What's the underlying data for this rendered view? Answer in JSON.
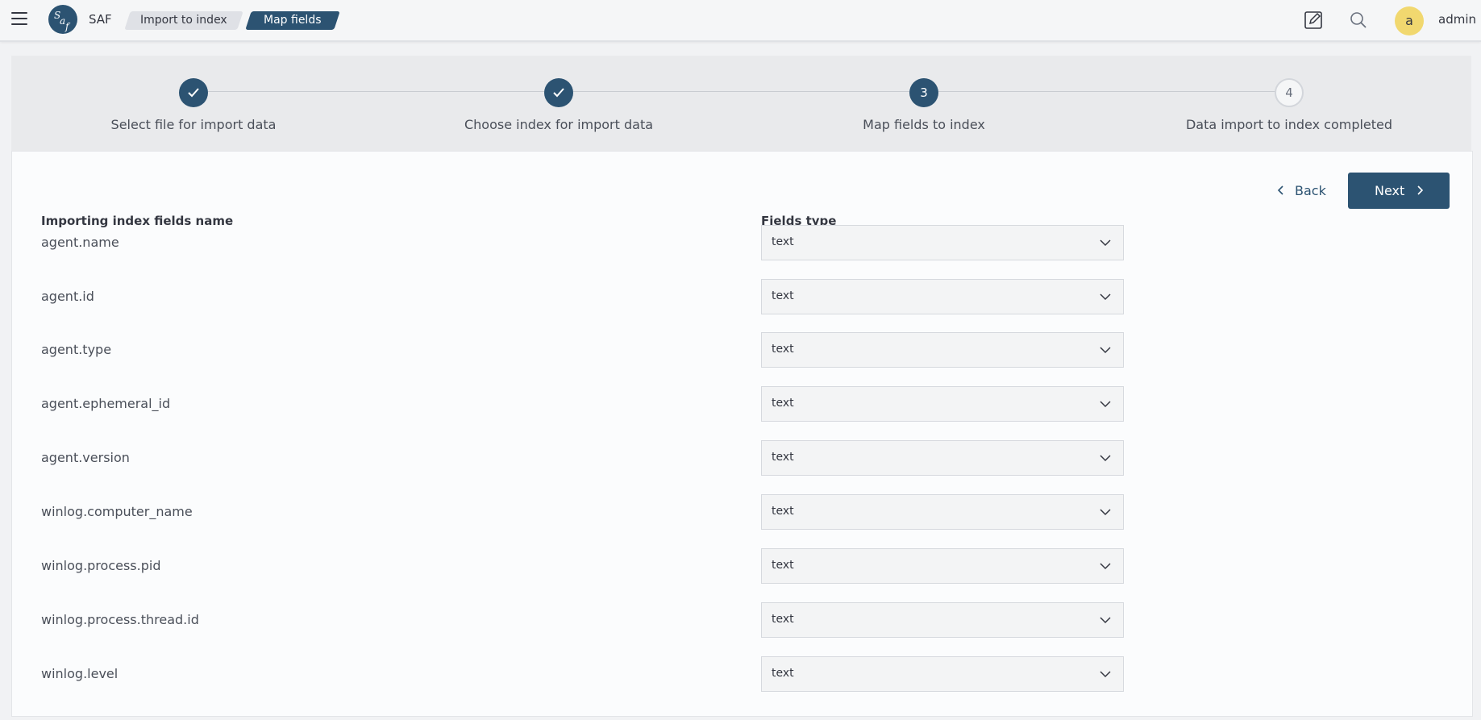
{
  "header": {
    "app_name": "SAF",
    "breadcrumbs": [
      "Import to index",
      "Map fields"
    ],
    "user": {
      "initial": "a",
      "name": "admin"
    },
    "icons": [
      "menu-icon",
      "saf-logo",
      "edit-icon",
      "search-icon"
    ]
  },
  "stepper": {
    "steps": [
      {
        "label": "Select file for import data",
        "state": "done",
        "marker": "✓"
      },
      {
        "label": "Choose index for import data",
        "state": "done",
        "marker": "✓"
      },
      {
        "label": "Map fields to index",
        "state": "current",
        "marker": "3"
      },
      {
        "label": "Data import to index completed",
        "state": "todo",
        "marker": "4"
      }
    ]
  },
  "actions": {
    "back_label": "Back",
    "next_label": "Next"
  },
  "mapping": {
    "name_header": "Importing index fields name",
    "type_header": "Fields type",
    "rows": [
      {
        "name": "agent.name",
        "type": "text"
      },
      {
        "name": "agent.id",
        "type": "text"
      },
      {
        "name": "agent.type",
        "type": "text"
      },
      {
        "name": "agent.ephemeral_id",
        "type": "text"
      },
      {
        "name": "agent.version",
        "type": "text"
      },
      {
        "name": "winlog.computer_name",
        "type": "text"
      },
      {
        "name": "winlog.process.pid",
        "type": "text"
      },
      {
        "name": "winlog.process.thread.id",
        "type": "text"
      },
      {
        "name": "winlog.level",
        "type": "text"
      }
    ]
  },
  "colors": {
    "primary": "#2c5372",
    "avatar": "#f1d86f"
  }
}
